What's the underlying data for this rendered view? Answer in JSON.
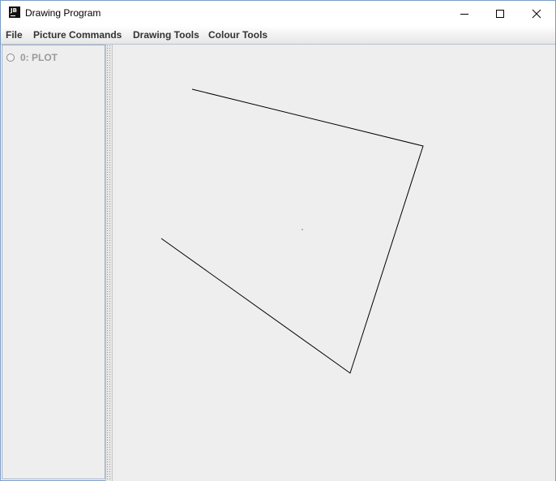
{
  "window": {
    "title": "Drawing Program",
    "icon_text": "JB"
  },
  "menu": {
    "items": [
      {
        "label": "File"
      },
      {
        "label": "Picture Commands"
      },
      {
        "label": "Drawing Tools"
      },
      {
        "label": "Colour Tools"
      }
    ]
  },
  "command_list": {
    "items": [
      {
        "label": "0: PLOT",
        "selected": false
      }
    ]
  },
  "drawing": {
    "stroke_color": "#000000",
    "background_color": "#eeeeee"
  }
}
